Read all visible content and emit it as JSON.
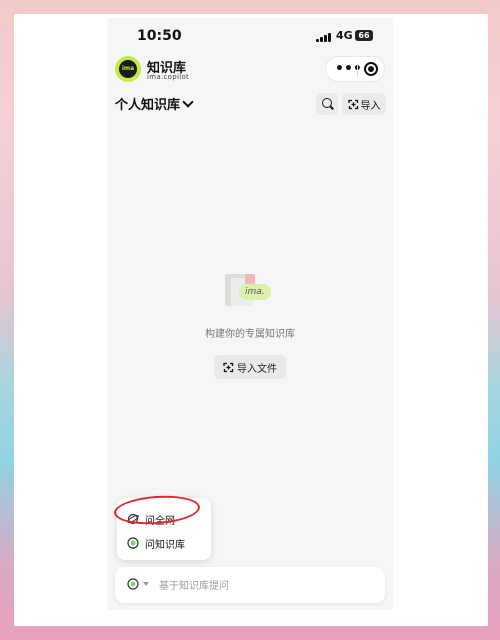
{
  "status_bar": {
    "time": "10:50",
    "network": "4G",
    "battery": "66"
  },
  "header": {
    "title": "知识库",
    "subtitle": "ima.copilot",
    "logo_text": "ima"
  },
  "toolbar": {
    "kb_title": "个人知识库",
    "import_label": "导入"
  },
  "empty_state": {
    "illustration_text": "ima.",
    "message": "构建你的专属知识库",
    "import_file_label": "导入文件"
  },
  "mode_menu": {
    "items": [
      {
        "label": "问全网"
      },
      {
        "label": "问知识库"
      }
    ]
  },
  "input": {
    "placeholder": "基于知识库提问"
  },
  "colors": {
    "accent": "#c3e94a",
    "annotation": "#e2262e",
    "background": "#f6f6f6"
  }
}
